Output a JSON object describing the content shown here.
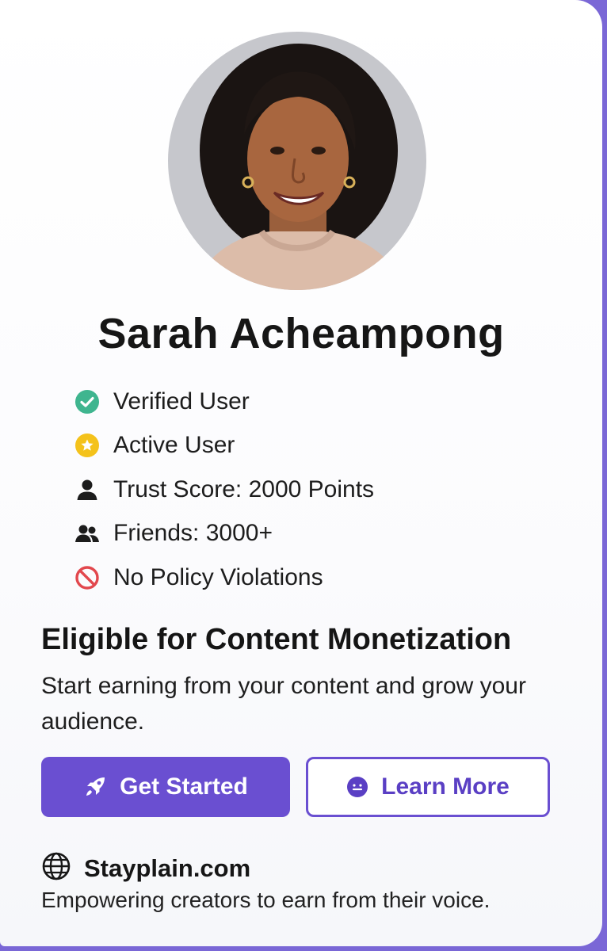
{
  "colors": {
    "accent": "#6a4fd1",
    "verified": "#3fb58f",
    "active": "#f4c21b",
    "violation": "#e2474d",
    "frame": "#7a67d6"
  },
  "profile": {
    "name": "Sarah Acheampong",
    "avatar_icon": "profile-photo"
  },
  "badges": [
    {
      "icon": "check-circle-icon",
      "label": "Verified User"
    },
    {
      "icon": "star-circle-icon",
      "label": "Active User"
    },
    {
      "icon": "person-icon",
      "label": "Trust Score: 2000 Points"
    },
    {
      "icon": "people-icon",
      "label": "Friends: 3000+"
    },
    {
      "icon": "prohibited-icon",
      "label": "No Policy Violations"
    }
  ],
  "monetization": {
    "title": "Eligible for Content Monetization",
    "description": "Start earning from your content and grow your audience."
  },
  "buttons": {
    "primary_label": "Get Started",
    "primary_icon": "rocket-icon",
    "secondary_label": "Learn More",
    "secondary_icon": "smiley-icon"
  },
  "footer": {
    "site": "Stayplain.com",
    "site_icon": "globe-icon",
    "tagline": "Empowering creators to earn from their voice."
  }
}
